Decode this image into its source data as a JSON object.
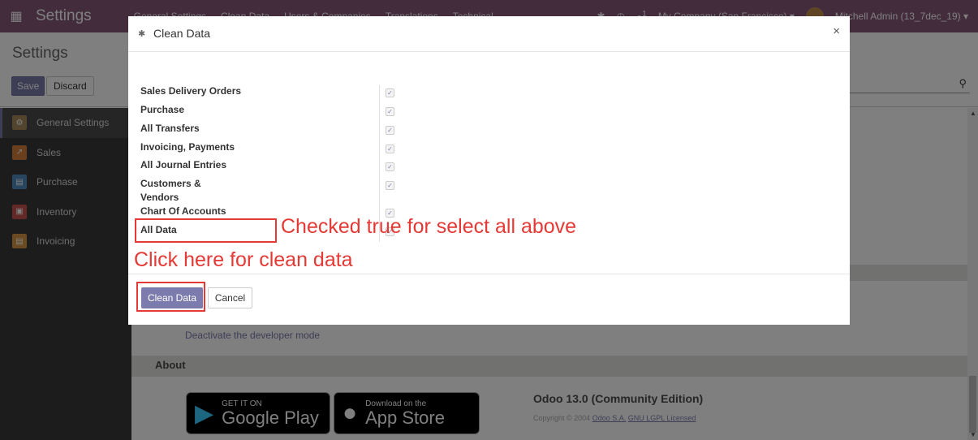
{
  "topbar": {
    "app_name": "Settings",
    "menus": [
      "General Settings",
      "Clean Data",
      "Users & Companies",
      "Translations",
      "Technical"
    ],
    "company": "My Company (San Francisco) ▾",
    "user": "Mitchell Admin (13_7dec_19) ▾",
    "chat_count": "1"
  },
  "control": {
    "title": "Settings",
    "save_label": "Save",
    "discard_label": "Discard"
  },
  "sidebar": {
    "items": [
      {
        "label": "General Settings",
        "color": "#a68a5b",
        "icon": "gear-icon"
      },
      {
        "label": "Sales",
        "color": "#d57e3c",
        "icon": "chart-icon"
      },
      {
        "label": "Purchase",
        "color": "#4f8abf",
        "icon": "card-icon"
      },
      {
        "label": "Inventory",
        "color": "#c7524d",
        "icon": "box-icon"
      },
      {
        "label": "Invoicing",
        "color": "#d59440",
        "icon": "invoice-icon"
      }
    ]
  },
  "background": {
    "dev_link": "Deactivate the developer mode",
    "about_title": "About",
    "google_play_small": "GET IT ON",
    "google_play_big": "Google Play",
    "app_store_small": "Download on the",
    "app_store_big": "App Store",
    "odoo_version": "Odoo 13.0 (Community Edition)",
    "copyright_prefix": "Copyright © 2004",
    "copyright_link1": "Odoo S.A.",
    "copyright_link2": "GNU LGPL Licensed"
  },
  "modal": {
    "title": "Clean Data",
    "close_symbol": "×",
    "fields": [
      {
        "label": "Sales Delivery Orders",
        "checked": true
      },
      {
        "label": "Purchase",
        "checked": true
      },
      {
        "label": "All Transfers",
        "checked": true
      },
      {
        "label": "Invoicing, Payments",
        "checked": true
      },
      {
        "label": "All Journal Entries",
        "checked": true
      },
      {
        "label": "Customers & Vendors",
        "checked": true
      },
      {
        "label": "Chart Of Accounts",
        "checked": true
      },
      {
        "label": "All Data",
        "checked": true
      }
    ],
    "clean_button": "Clean Data",
    "cancel_button": "Cancel"
  },
  "annotations": {
    "checked_note": "Checked true for select all above",
    "click_note": "Click here for clean data"
  },
  "colors": {
    "brand": "#875a7b",
    "primary_button": "#7c7bad",
    "annotation": "#e53935"
  }
}
